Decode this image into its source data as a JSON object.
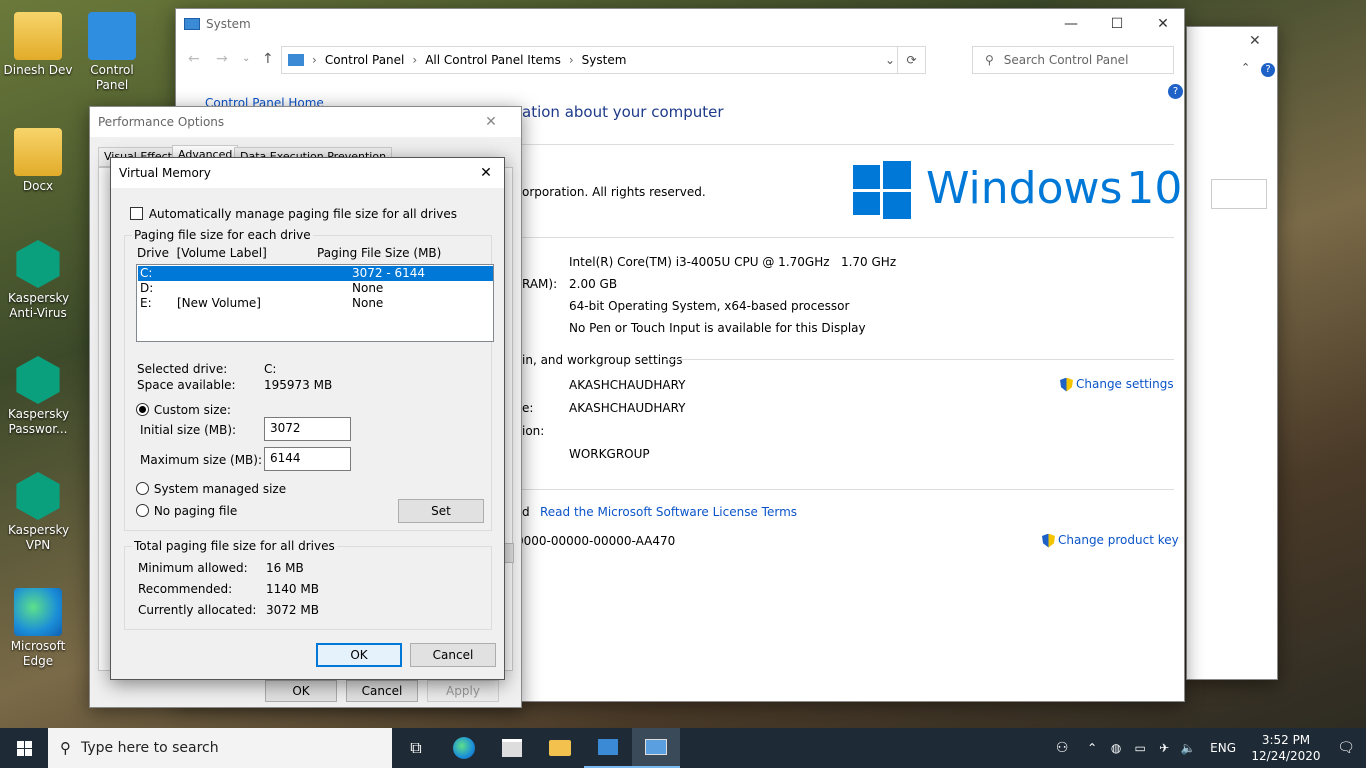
{
  "desktop": {
    "icons": [
      {
        "label": "Dinesh Dev"
      },
      {
        "label": "Control Panel"
      },
      {
        "label": "Docx"
      },
      {
        "label": "Kaspersky Anti-Virus"
      },
      {
        "label": "Kaspersky Passwor..."
      },
      {
        "label": "Kaspersky VPN"
      },
      {
        "label": "Microsoft Edge"
      }
    ]
  },
  "system_window": {
    "title": "System",
    "breadcrumb": [
      "Control Panel",
      "All Control Panel Items",
      "System"
    ],
    "search_placeholder": "Search Control Panel",
    "left_link": "Control Panel Home",
    "heading": "ation about your computer",
    "copyright": "orporation. All rights reserved.",
    "logo_text": "Windows",
    "logo_num": "10",
    "specs": {
      "processor": "Intel(R) Core(TM) i3-4005U CPU @ 1.70GHz   1.70 GHz",
      "ram_label": "RAM):",
      "ram": "2.00 GB",
      "system_type": "64-bit Operating System, x64-based processor",
      "pen": "No Pen or Touch Input is available for this Display"
    },
    "section_title": "in, and workgroup settings",
    "computer_name": "AKASHCHAUDHARY",
    "full_name_label": "e:",
    "full_name": "AKASHCHAUDHARY",
    "desc_label": "ion:",
    "workgroup": "WORKGROUP",
    "change_settings": "Change settings",
    "activation_prefix": "d",
    "license_link": "Read the Microsoft Software License Terms",
    "product_id": "0000-00000-00000-AA470",
    "change_key": "Change product key"
  },
  "perf_options": {
    "title": "Performance Options",
    "tabs": [
      "Visual Effects",
      "Advanced",
      "Data Execution Prevention"
    ],
    "ok": "OK",
    "cancel": "Cancel",
    "apply": "Apply"
  },
  "virtual_memory": {
    "title": "Virtual Memory",
    "auto_manage": "Automatically manage paging file size for all drives",
    "group_title": "Paging file size for each drive",
    "col_drive": "Drive  [Volume Label]",
    "col_size": "Paging File Size (MB)",
    "drives": [
      {
        "drive": "C:",
        "label": "",
        "size": "3072 - 6144"
      },
      {
        "drive": "D:",
        "label": "",
        "size": "None"
      },
      {
        "drive": "E:",
        "label": "[New Volume]",
        "size": "None"
      }
    ],
    "selected_drive_label": "Selected drive:",
    "selected_drive": "C:",
    "space_label": "Space available:",
    "space": "195973 MB",
    "custom_size": "Custom size:",
    "initial_label": "Initial size (MB):",
    "initial_value": "3072",
    "max_label": "Maximum size (MB):",
    "max_value": "6144",
    "system_managed": "System managed size",
    "no_paging": "No paging file",
    "set": "Set",
    "total_title": "Total paging file size for all drives",
    "min_label": "Minimum allowed:",
    "min_value": "16 MB",
    "rec_label": "Recommended:",
    "rec_value": "1140 MB",
    "cur_label": "Currently allocated:",
    "cur_value": "3072 MB",
    "ok": "OK",
    "cancel": "Cancel"
  },
  "taskbar": {
    "search_placeholder": "Type here to search",
    "lang": "ENG",
    "time": "3:52 PM",
    "date": "12/24/2020"
  }
}
